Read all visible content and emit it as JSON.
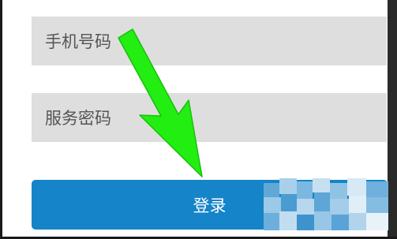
{
  "form": {
    "phone_placeholder": "手机号码",
    "password_placeholder": "服务密码",
    "login_label": "登录"
  },
  "colors": {
    "field_bg": "#dedede",
    "button_bg": "#1584c8",
    "arrow": "#22ee11"
  },
  "icons": {
    "annotation": "arrow-down-right-icon"
  }
}
